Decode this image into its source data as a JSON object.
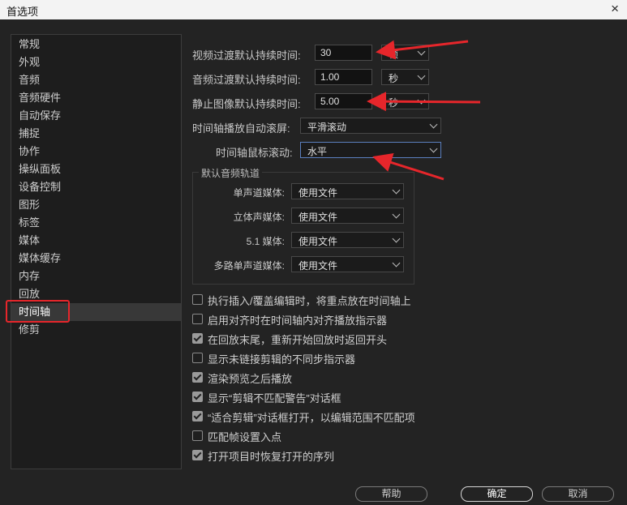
{
  "window": {
    "title": "首选项",
    "close_icon": "×"
  },
  "sidebar": {
    "items": [
      "常规",
      "外观",
      "音频",
      "音频硬件",
      "自动保存",
      "捕捉",
      "协作",
      "操纵面板",
      "设备控制",
      "图形",
      "标签",
      "媒体",
      "媒体缓存",
      "内存",
      "回放",
      "时间轴",
      "修剪"
    ],
    "selected": "时间轴"
  },
  "settings": {
    "video_transition": {
      "label": "视频过渡默认持续时间:",
      "value": "30",
      "unit": "帧"
    },
    "audio_transition": {
      "label": "音频过渡默认持续时间:",
      "value": "1.00",
      "unit": "秒"
    },
    "still_image": {
      "label": "静止图像默认持续时间:",
      "value": "5.00",
      "unit": "秒"
    },
    "autoscroll": {
      "label": "时间轴播放自动滚屏:",
      "value": "平滑滚动"
    },
    "mouse_scroll": {
      "label": "时间轴鼠标滚动:",
      "value": "水平"
    }
  },
  "audio_tracks": {
    "title": "默认音频轨道",
    "rows": [
      {
        "label": "单声道媒体:",
        "value": "使用文件"
      },
      {
        "label": "立体声媒体:",
        "value": "使用文件"
      },
      {
        "label": "5.1 媒体:",
        "value": "使用文件"
      },
      {
        "label": "多路单声道媒体:",
        "value": "使用文件"
      }
    ]
  },
  "checkboxes": [
    {
      "label": "执行插入/覆盖编辑时，将重点放在时间轴上",
      "checked": false
    },
    {
      "label": "启用对齐时在时间轴内对齐播放指示器",
      "checked": false
    },
    {
      "label": "在回放末尾，重新开始回放时返回开头",
      "checked": true
    },
    {
      "label": "显示未链接剪辑的不同步指示器",
      "checked": false
    },
    {
      "label": "渲染预览之后播放",
      "checked": true
    },
    {
      "label": "显示“剪辑不匹配警告”对话框",
      "checked": true
    },
    {
      "label": "“适合剪辑”对话框打开，以编辑范围不匹配项",
      "checked": true
    },
    {
      "label": "匹配帧设置入点",
      "checked": false
    },
    {
      "label": "打开项目时恢复打开的序列",
      "checked": true
    }
  ],
  "buttons": {
    "help": "帮助",
    "ok": "确定",
    "cancel": "取消"
  },
  "colors": {
    "annotation_red": "#e6262b",
    "focus_blue": "#5b7fbe"
  }
}
